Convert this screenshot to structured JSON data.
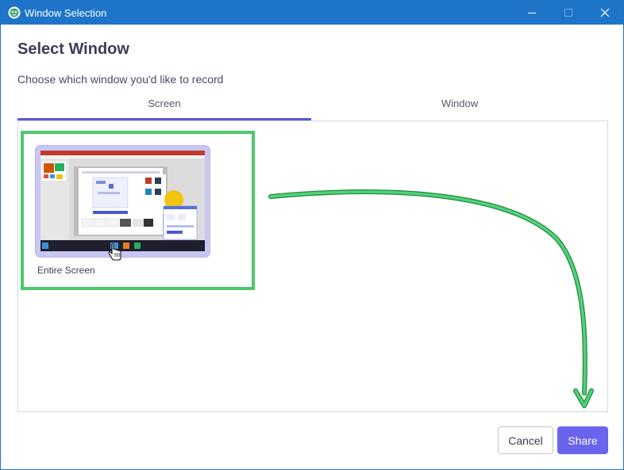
{
  "window": {
    "title": "Window Selection",
    "controls": {
      "minimize_icon": "minimize-icon",
      "maximize_icon": "maximize-icon",
      "close_icon": "close-icon"
    }
  },
  "dialog": {
    "heading": "Select Window",
    "subtitle": "Choose which window you'd like to record",
    "tabs": [
      {
        "label": "Screen",
        "selected": true
      },
      {
        "label": "Window",
        "selected": false
      }
    ],
    "sources": [
      {
        "label": "Entire Screen",
        "selected": true
      }
    ]
  },
  "buttons": {
    "cancel": "Cancel",
    "share": "Share"
  },
  "colors": {
    "titlebar": "#1e74c9",
    "accent": "#5b57d9",
    "share_button": "#6a63ee",
    "highlight": "#4cc96b",
    "thumbnail_border": "#c8c7f2"
  }
}
